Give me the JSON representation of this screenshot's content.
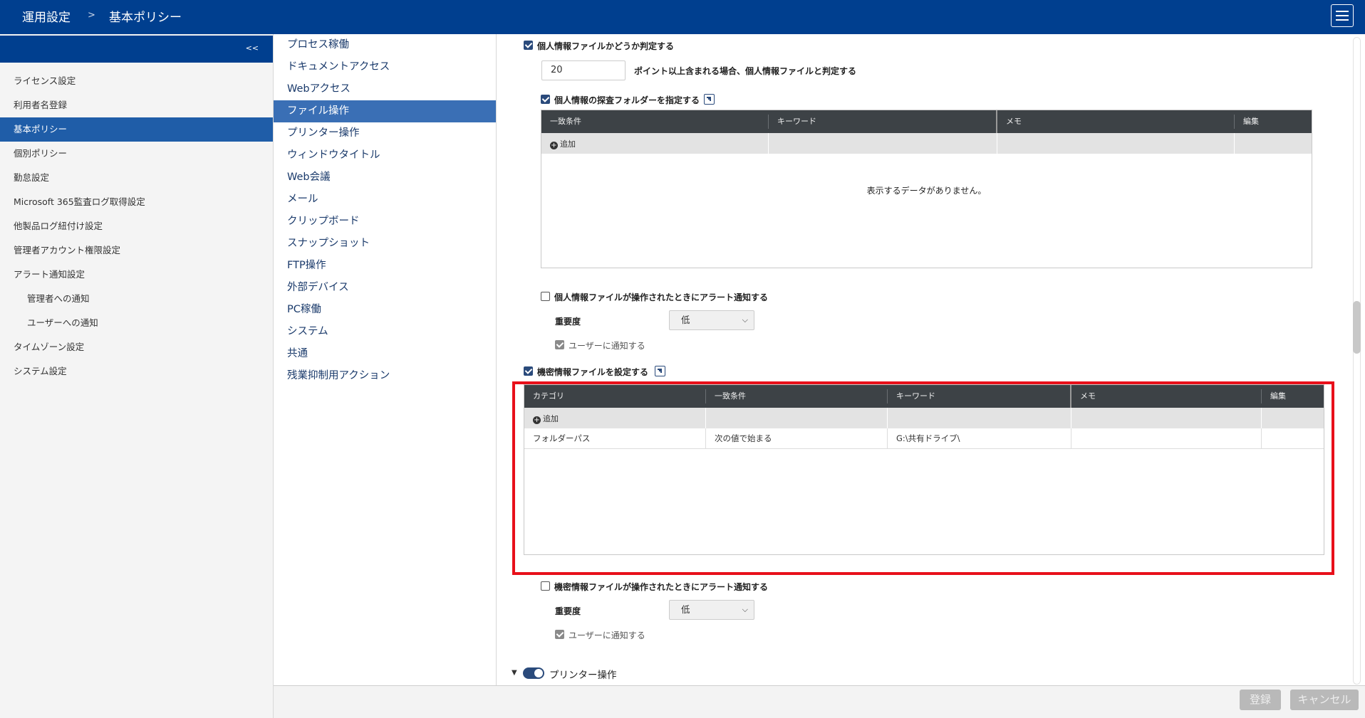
{
  "header": {
    "crumb_root": "運用設定",
    "crumb_sep": ">",
    "crumb_current": "基本ポリシー"
  },
  "sidebar": {
    "collapse_label": "<<",
    "items": [
      {
        "label": "ライセンス設定"
      },
      {
        "label": "利用者名登録"
      },
      {
        "label": "基本ポリシー"
      },
      {
        "label": "個別ポリシー"
      },
      {
        "label": "勤怠設定"
      },
      {
        "label": "Microsoft 365監査ログ取得設定"
      },
      {
        "label": "他製品ログ紐付け設定"
      },
      {
        "label": "管理者アカウント権限設定"
      },
      {
        "label": "アラート通知設定"
      },
      {
        "label": "管理者への通知"
      },
      {
        "label": "ユーザーへの通知"
      },
      {
        "label": "タイムゾーン設定"
      },
      {
        "label": "システム設定"
      }
    ]
  },
  "policy_nav": {
    "items": [
      {
        "label": "プロセス稼働"
      },
      {
        "label": "ドキュメントアクセス"
      },
      {
        "label": "Webアクセス"
      },
      {
        "label": "ファイル操作"
      },
      {
        "label": "プリンター操作"
      },
      {
        "label": "ウィンドウタイトル"
      },
      {
        "label": "Web会議"
      },
      {
        "label": "メール"
      },
      {
        "label": "クリップボード"
      },
      {
        "label": "スナップショット"
      },
      {
        "label": "FTP操作"
      },
      {
        "label": "外部デバイス"
      },
      {
        "label": "PC稼働"
      },
      {
        "label": "システム"
      },
      {
        "label": "共通"
      },
      {
        "label": "残業抑制用アクション"
      }
    ]
  },
  "personal_info": {
    "judge_label": "個人情報ファイルかどうか判定する",
    "points_value": "20",
    "points_suffix": "ポイント以上含まれる場合、個人情報ファイルと判定する",
    "folder_label": "個人情報の探査フォルダーを指定する",
    "grid": {
      "columns": [
        "一致条件",
        "キーワード",
        "メモ",
        "編集"
      ],
      "add_label": "追加",
      "empty_message": "表示するデータがありません。"
    },
    "alert_label": "個人情報ファイルが操作されたときにアラート通知する",
    "severity_label": "重要度",
    "severity_value": "低",
    "notify_user_label": "ユーザーに通知する"
  },
  "confidential": {
    "set_label": "機密情報ファイルを設定する",
    "grid": {
      "columns": [
        "カテゴリ",
        "一致条件",
        "キーワード",
        "メモ",
        "編集"
      ],
      "add_label": "追加",
      "rows": [
        {
          "category": "フォルダーパス",
          "condition": "次の値で始まる",
          "keyword": "G:\\共有ドライブ\\",
          "memo": "",
          "edit": ""
        }
      ]
    },
    "alert_label": "機密情報ファイルが操作されたときにアラート通知する",
    "severity_label": "重要度",
    "severity_value": "低",
    "notify_user_label": "ユーザーに通知する"
  },
  "printer_section": {
    "label": "プリンター操作"
  },
  "footer": {
    "register_label": "登録",
    "cancel_label": "キャンセル"
  }
}
